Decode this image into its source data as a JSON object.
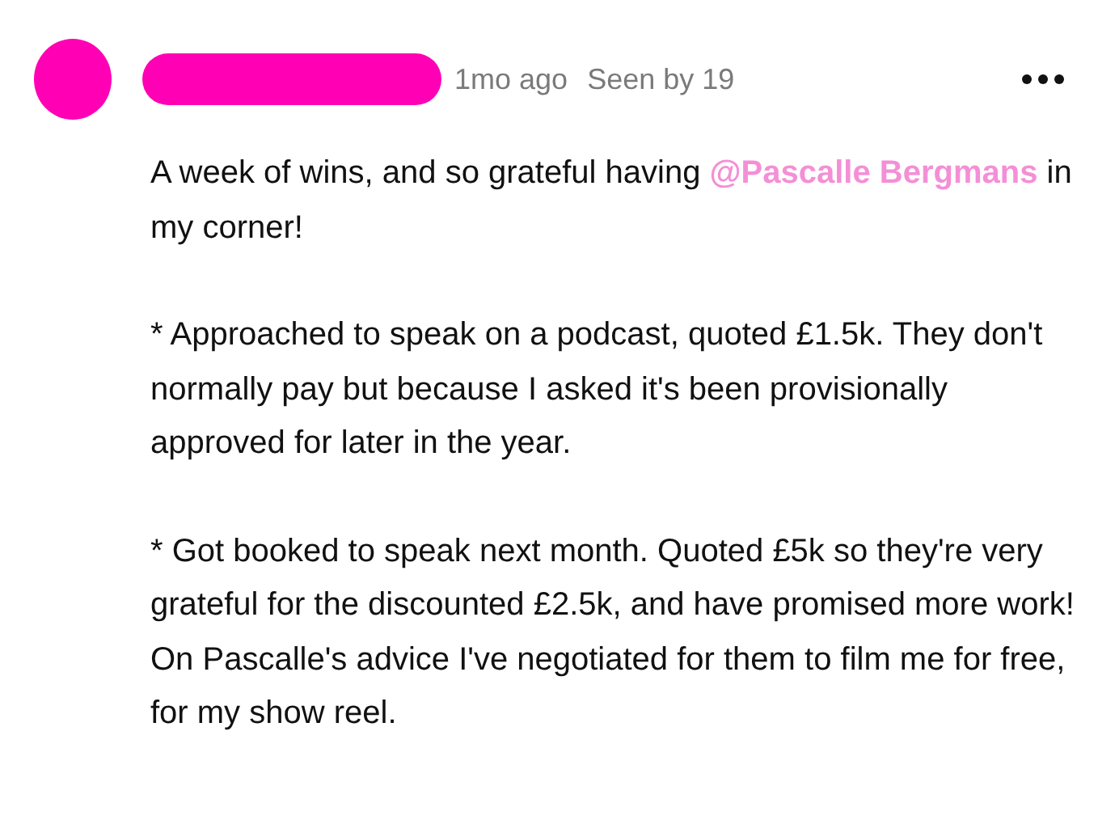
{
  "post": {
    "time": "1mo ago",
    "seen": "Seen by 19",
    "paragraphs": [
      {
        "parts": [
          {
            "kind": "text",
            "text": "A week of wins, and so grateful having "
          },
          {
            "kind": "mention",
            "text": "@Pascalle Bergmans"
          },
          {
            "kind": "text",
            "text": " in my corner!"
          }
        ]
      },
      {
        "parts": [
          {
            "kind": "text",
            "text": "* Approached to speak on a podcast, quoted £1.5k. They don't normally pay but because I asked it's been provisionally approved for later in the year."
          }
        ]
      },
      {
        "parts": [
          {
            "kind": "text",
            "text": "* Got booked to speak next month. Quoted £5k so they're very grateful for the discounted £2.5k, and have promised more work! On Pascalle's advice I've negotiated for them to film me for free, for my show reel."
          }
        ]
      }
    ]
  }
}
